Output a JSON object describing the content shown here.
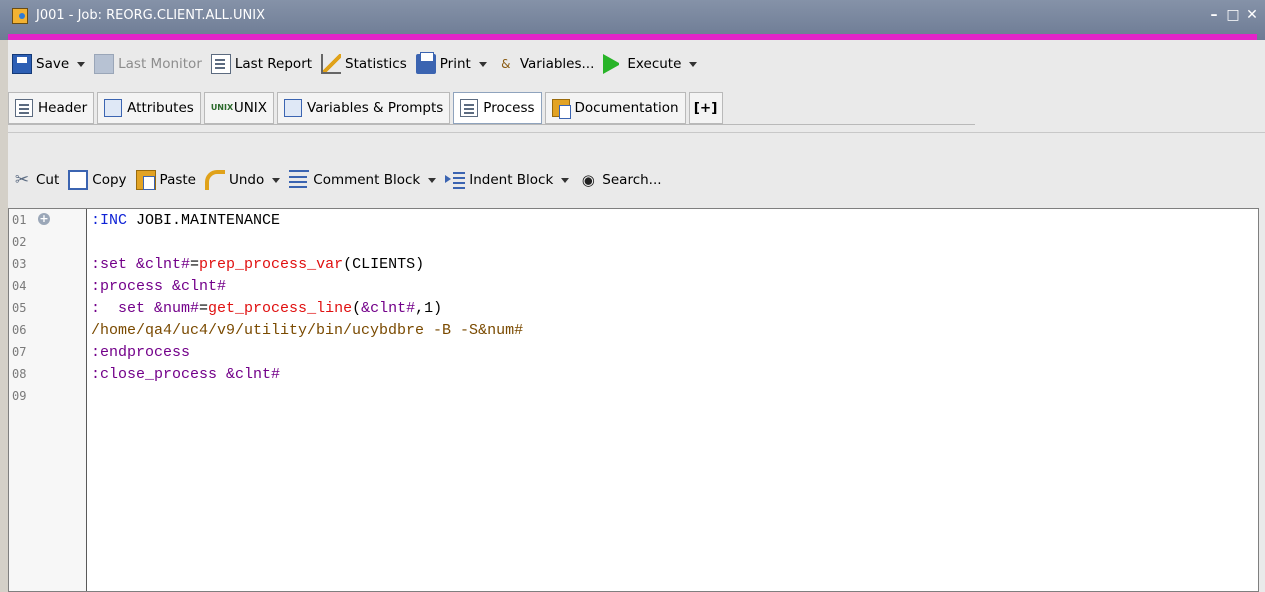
{
  "window": {
    "title": "J001 - Job: REORG.CLIENT.ALL.UNIX",
    "min": "–",
    "max": "□",
    "close": "✕"
  },
  "toolbar": {
    "save": "Save",
    "last_monitor": "Last Monitor",
    "last_report": "Last Report",
    "statistics": "Statistics",
    "print": "Print",
    "variables": "Variables...",
    "execute": "Execute"
  },
  "tabs": {
    "header": "Header",
    "attributes": "Attributes",
    "unix": "UNIX",
    "unix_icon": "UNIX",
    "variables_prompts": "Variables & Prompts",
    "process": "Process",
    "documentation": "Documentation",
    "add": "[+]"
  },
  "edit_toolbar": {
    "cut": "Cut",
    "copy": "Copy",
    "paste": "Paste",
    "undo": "Undo",
    "comment_block": "Comment Block",
    "indent_block": "Indent Block",
    "search": "Search..."
  },
  "editor": {
    "line_numbers": [
      "01",
      "02",
      "03",
      "04",
      "05",
      "06",
      "07",
      "08",
      "09"
    ],
    "fold_symbol": "+",
    "lines": {
      "l1": {
        "a": ":INC",
        "b": " JOBI.MAINTENANCE"
      },
      "l3": {
        "a": ":set",
        "b": " &clnt#",
        "c": "=",
        "d": "prep_process_var",
        "e": "(CLIENTS)"
      },
      "l4": {
        "a": ":process",
        "b": " &clnt#"
      },
      "l5": {
        "a": ":  set",
        "b": " &num#",
        "c": "=",
        "d": "get_process_line",
        "e": "(",
        "f": "&clnt#",
        "g": ",1)"
      },
      "l6": {
        "a": "/home/qa4/uc4/v9/utility/bin/ucybdbre -B -S",
        "b": "&num#"
      },
      "l7": {
        "a": ":endprocess"
      },
      "l8": {
        "a": ":close_process",
        "b": " &clnt#"
      }
    }
  }
}
